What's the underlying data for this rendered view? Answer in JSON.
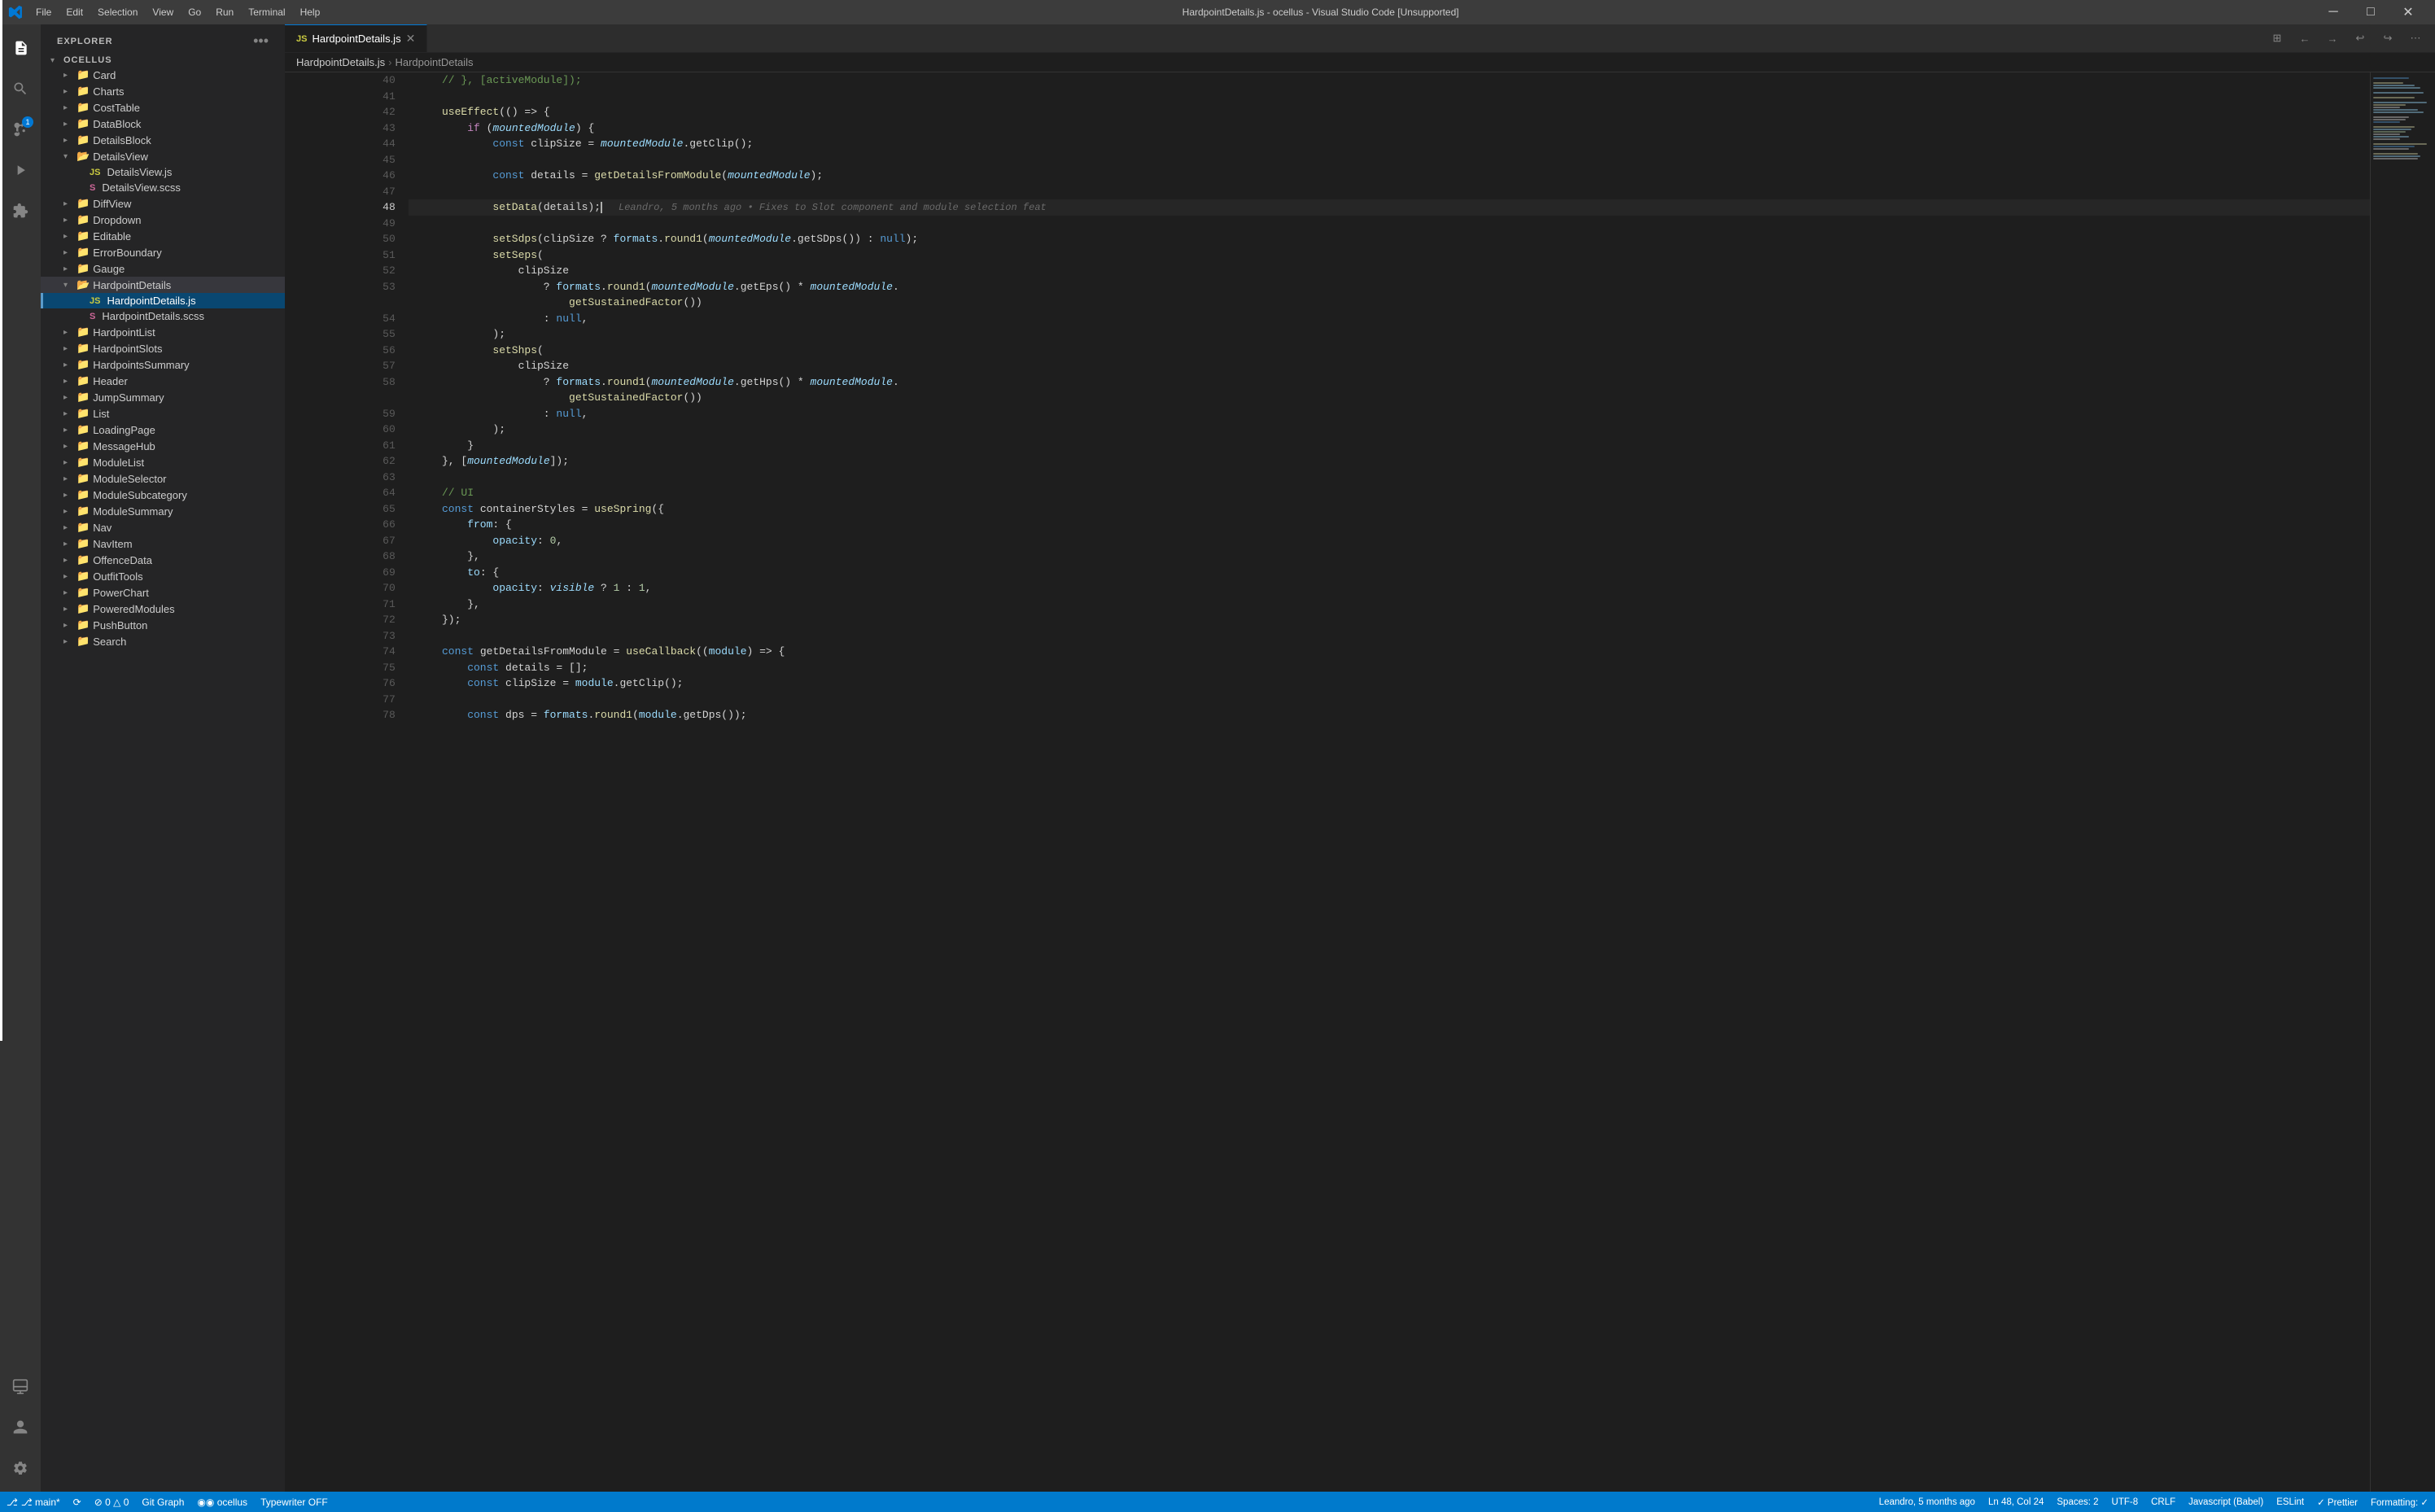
{
  "window": {
    "title": "HardpointDetails.js - ocellus - Visual Studio Code [Unsupported]",
    "menuItems": [
      "File",
      "Edit",
      "Selection",
      "View",
      "Go",
      "Run",
      "Terminal",
      "Help"
    ]
  },
  "activityBar": {
    "items": [
      {
        "name": "explorer",
        "icon": "📁",
        "active": true
      },
      {
        "name": "search",
        "icon": "🔍",
        "active": false
      },
      {
        "name": "source-control",
        "icon": "⑂",
        "active": false,
        "badge": "1"
      },
      {
        "name": "run-debug",
        "icon": "▷",
        "active": false
      },
      {
        "name": "extensions",
        "icon": "⊞",
        "active": false
      }
    ],
    "bottomItems": [
      {
        "name": "remote-explorer",
        "icon": "🖥"
      },
      {
        "name": "accounts",
        "icon": "👤"
      },
      {
        "name": "settings",
        "icon": "⚙"
      }
    ]
  },
  "sidebar": {
    "title": "Explorer",
    "moreIcon": "•••",
    "rootSection": "OCELLUS",
    "treeItems": [
      {
        "label": "Card",
        "type": "folder",
        "level": 2,
        "open": false
      },
      {
        "label": "Charts",
        "type": "folder",
        "level": 2,
        "open": false
      },
      {
        "label": "CostTable",
        "type": "folder",
        "level": 2,
        "open": false
      },
      {
        "label": "DataBlock",
        "type": "folder",
        "level": 2,
        "open": false
      },
      {
        "label": "DetailsBlock",
        "type": "folder",
        "level": 2,
        "open": false
      },
      {
        "label": "DetailsView",
        "type": "folder",
        "level": 2,
        "open": true
      },
      {
        "label": "DetailsView.js",
        "type": "file-js",
        "level": 3
      },
      {
        "label": "DetailsView.scss",
        "type": "file-scss",
        "level": 3
      },
      {
        "label": "DiffView",
        "type": "folder",
        "level": 2,
        "open": false
      },
      {
        "label": "Dropdown",
        "type": "folder",
        "level": 2,
        "open": false
      },
      {
        "label": "Editable",
        "type": "folder",
        "level": 2,
        "open": false
      },
      {
        "label": "ErrorBoundary",
        "type": "folder",
        "level": 2,
        "open": false
      },
      {
        "label": "Gauge",
        "type": "folder",
        "level": 2,
        "open": false
      },
      {
        "label": "HardpointDetails",
        "type": "folder",
        "level": 2,
        "open": true
      },
      {
        "label": "HardpointDetails.js",
        "type": "file-js",
        "level": 3,
        "active": true,
        "selected": true
      },
      {
        "label": "HardpointDetails.scss",
        "type": "file-scss",
        "level": 3
      },
      {
        "label": "HardpointList",
        "type": "folder",
        "level": 2,
        "open": false
      },
      {
        "label": "HardpointSlots",
        "type": "folder",
        "level": 2,
        "open": false
      },
      {
        "label": "HardpointsSummary",
        "type": "folder",
        "level": 2,
        "open": false
      },
      {
        "label": "Header",
        "type": "folder",
        "level": 2,
        "open": false
      },
      {
        "label": "JumpSummary",
        "type": "folder",
        "level": 2,
        "open": false
      },
      {
        "label": "List",
        "type": "folder",
        "level": 2,
        "open": false
      },
      {
        "label": "LoadingPage",
        "type": "folder",
        "level": 2,
        "open": false
      },
      {
        "label": "MessageHub",
        "type": "folder",
        "level": 2,
        "open": false
      },
      {
        "label": "ModuleList",
        "type": "folder",
        "level": 2,
        "open": false
      },
      {
        "label": "ModuleSelector",
        "type": "folder",
        "level": 2,
        "open": false
      },
      {
        "label": "ModuleSubcategory",
        "type": "folder",
        "level": 2,
        "open": false
      },
      {
        "label": "ModuleSummary",
        "type": "folder",
        "level": 2,
        "open": false
      },
      {
        "label": "Nav",
        "type": "folder",
        "level": 2,
        "open": false
      },
      {
        "label": "NavItem",
        "type": "folder",
        "level": 2,
        "open": false
      },
      {
        "label": "OffenceData",
        "type": "folder",
        "level": 2,
        "open": false
      },
      {
        "label": "OutfitTools",
        "type": "folder",
        "level": 2,
        "open": false
      },
      {
        "label": "PowerChart",
        "type": "folder",
        "level": 2,
        "open": false
      },
      {
        "label": "PoweredModules",
        "type": "folder",
        "level": 2,
        "open": false
      },
      {
        "label": "PushButton",
        "type": "folder",
        "level": 2,
        "open": false
      },
      {
        "label": "Search",
        "type": "folder",
        "level": 2,
        "open": false
      }
    ]
  },
  "editor": {
    "fileName": "HardpointDetails.js",
    "filePath": "HardpointDetails",
    "tabLabel": "HardpointDetails.js",
    "breadcrumb": [
      "HardpointDetails.js",
      "HardpointDetails"
    ],
    "lines": [
      {
        "num": 40,
        "content": "    // }, [activeModule]);",
        "tokens": [
          {
            "t": "cmt",
            "v": "// }, [activeModule]);"
          }
        ]
      },
      {
        "num": 41,
        "content": ""
      },
      {
        "num": 42,
        "content": "    useEffect(() => {",
        "tokens": [
          {
            "t": "fn",
            "v": "useEffect"
          },
          {
            "t": "punct",
            "v": "(() => {"
          }
        ]
      },
      {
        "num": 43,
        "content": "        if (mountedModule) {",
        "tokens": [
          {
            "t": "kw2",
            "v": "if"
          },
          {
            "t": "op",
            "v": " ("
          },
          {
            "t": "italic",
            "v": "mountedModule"
          },
          {
            "t": "op",
            "v": ") {"
          }
        ]
      },
      {
        "num": 44,
        "content": "            const clipSize = mountedModule.getClip();",
        "tokens": [
          {
            "t": "kw",
            "v": "const"
          },
          {
            "t": "op",
            "v": " clipSize = "
          },
          {
            "t": "italic",
            "v": "mountedModule"
          },
          {
            "t": "op",
            "v": ".getClip();"
          }
        ]
      },
      {
        "num": 45,
        "content": ""
      },
      {
        "num": 46,
        "content": "            const details = getDetailsFromModule(mountedModule);",
        "tokens": [
          {
            "t": "kw",
            "v": "const"
          },
          {
            "t": "op",
            "v": " details = "
          },
          {
            "t": "fn",
            "v": "getDetailsFromModule"
          },
          {
            "t": "op",
            "v": "("
          },
          {
            "t": "italic",
            "v": "mountedModule"
          },
          {
            "t": "op",
            "v": ");"
          }
        ]
      },
      {
        "num": 47,
        "content": ""
      },
      {
        "num": 48,
        "content": "            setData(details);",
        "blame": "Leandro, 5 months ago • Fixes to Slot component and module selection feat",
        "tokens": [
          {
            "t": "fn",
            "v": "setData"
          },
          {
            "t": "op",
            "v": "(details);"
          },
          {
            "t": "cursor",
            "v": ""
          }
        ],
        "active": true
      },
      {
        "num": 49,
        "content": ""
      },
      {
        "num": 50,
        "content": "            setSdps(clipSize ? formats.round1(mountedModule.getSDps()) : null);",
        "tokens": [
          {
            "t": "fn",
            "v": "setSdps"
          },
          {
            "t": "op",
            "v": "(clipSize ? "
          },
          {
            "t": "var",
            "v": "formats"
          },
          {
            "t": "op",
            "v": "."
          },
          {
            "t": "fn",
            "v": "round1"
          },
          {
            "t": "op",
            "v": "("
          },
          {
            "t": "italic",
            "v": "mountedModule"
          },
          {
            "t": "op",
            "v": ".getSDps()) : "
          },
          {
            "t": "kw",
            "v": "null"
          },
          {
            "t": "op",
            "v": ");"
          }
        ]
      },
      {
        "num": 51,
        "content": "            setSeps(",
        "tokens": [
          {
            "t": "fn",
            "v": "setSeps"
          },
          {
            "t": "op",
            "v": "("
          }
        ]
      },
      {
        "num": 52,
        "content": "                clipSize",
        "tokens": [
          {
            "t": "op",
            "v": "                clipSize"
          }
        ]
      },
      {
        "num": 53,
        "content": "                    ? formats.round1(mountedModule.getEps() * mountedModule.",
        "tokens": [
          {
            "t": "op",
            "v": "                    ? "
          },
          {
            "t": "var",
            "v": "formats"
          },
          {
            "t": "op",
            "v": "."
          },
          {
            "t": "fn",
            "v": "round1"
          },
          {
            "t": "op",
            "v": "("
          },
          {
            "t": "italic",
            "v": "mountedModule"
          },
          {
            "t": "op",
            "v": ".getEps() * "
          },
          {
            "t": "italic",
            "v": "mountedModule"
          },
          {
            "t": "op",
            "v": "."
          }
        ]
      },
      {
        "num": "",
        "content": "                        getSustainedFactor())",
        "tokens": [
          {
            "t": "fn",
            "v": "                        getSustainedFactor"
          },
          {
            "t": "op",
            "v": "())"
          }
        ]
      },
      {
        "num": 54,
        "content": "                    : null,",
        "tokens": [
          {
            "t": "op",
            "v": "                    : "
          },
          {
            "t": "kw",
            "v": "null"
          },
          {
            "t": "op",
            "v": ","
          }
        ]
      },
      {
        "num": 55,
        "content": "            );",
        "tokens": [
          {
            "t": "op",
            "v": "            );"
          }
        ]
      },
      {
        "num": 56,
        "content": "            setShps(",
        "tokens": [
          {
            "t": "fn",
            "v": "setShps"
          },
          {
            "t": "op",
            "v": "("
          }
        ]
      },
      {
        "num": 57,
        "content": "                clipSize",
        "tokens": [
          {
            "t": "op",
            "v": "                clipSize"
          }
        ]
      },
      {
        "num": 58,
        "content": "                    ? formats.round1(mountedModule.getHps() * mountedModule.",
        "tokens": [
          {
            "t": "op",
            "v": "                    ? "
          },
          {
            "t": "var",
            "v": "formats"
          },
          {
            "t": "op",
            "v": "."
          },
          {
            "t": "fn",
            "v": "round1"
          },
          {
            "t": "op",
            "v": "("
          },
          {
            "t": "italic",
            "v": "mountedModule"
          },
          {
            "t": "op",
            "v": ".getHps() * "
          },
          {
            "t": "italic",
            "v": "mountedModule"
          },
          {
            "t": "op",
            "v": "."
          }
        ]
      },
      {
        "num": "",
        "content": "                        getSustainedFactor())",
        "tokens": [
          {
            "t": "fn",
            "v": "                        getSustainedFactor"
          },
          {
            "t": "op",
            "v": "())"
          }
        ]
      },
      {
        "num": 59,
        "content": "                    : null,",
        "tokens": [
          {
            "t": "op",
            "v": "                    : "
          },
          {
            "t": "kw",
            "v": "null"
          },
          {
            "t": "op",
            "v": ","
          }
        ]
      },
      {
        "num": 60,
        "content": "            );",
        "tokens": [
          {
            "t": "op",
            "v": "            );"
          }
        ]
      },
      {
        "num": 61,
        "content": "        }",
        "tokens": [
          {
            "t": "op",
            "v": "        }"
          }
        ]
      },
      {
        "num": 62,
        "content": "    }, [mountedModule]);",
        "tokens": [
          {
            "t": "op",
            "v": "    }, ["
          },
          {
            "t": "italic",
            "v": "mountedModule"
          },
          {
            "t": "op",
            "v": "]);"
          }
        ]
      },
      {
        "num": 63,
        "content": ""
      },
      {
        "num": 64,
        "content": "    // UI",
        "tokens": [
          {
            "t": "cmt",
            "v": "    // UI"
          }
        ]
      },
      {
        "num": 65,
        "content": "    const containerStyles = useSpring({",
        "tokens": [
          {
            "t": "kw",
            "v": "    const"
          },
          {
            "t": "op",
            "v": " containerStyles = "
          },
          {
            "t": "fn",
            "v": "useSpring"
          },
          {
            "t": "op",
            "v": "({"
          }
        ]
      },
      {
        "num": 66,
        "content": "        from: {",
        "tokens": [
          {
            "t": "prop",
            "v": "        from"
          },
          {
            "t": "op",
            "v": ": {"
          }
        ]
      },
      {
        "num": 67,
        "content": "            opacity: 0,",
        "tokens": [
          {
            "t": "prop",
            "v": "            opacity"
          },
          {
            "t": "op",
            "v": ": "
          },
          {
            "t": "num",
            "v": "0"
          },
          {
            "t": "op",
            "v": ","
          }
        ]
      },
      {
        "num": 68,
        "content": "        },",
        "tokens": [
          {
            "t": "op",
            "v": "        },"
          }
        ]
      },
      {
        "num": 69,
        "content": "        to: {",
        "tokens": [
          {
            "t": "prop",
            "v": "        to"
          },
          {
            "t": "op",
            "v": ": {"
          }
        ]
      },
      {
        "num": 70,
        "content": "            opacity: visible ? 1 : 1,",
        "tokens": [
          {
            "t": "prop",
            "v": "            opacity"
          },
          {
            "t": "op",
            "v": ": "
          },
          {
            "t": "italic",
            "v": "visible"
          },
          {
            "t": "op",
            "v": " ? "
          },
          {
            "t": "num",
            "v": "1"
          },
          {
            "t": "op",
            "v": " : "
          },
          {
            "t": "num",
            "v": "1"
          },
          {
            "t": "op",
            "v": ","
          }
        ]
      },
      {
        "num": 71,
        "content": "        },",
        "tokens": [
          {
            "t": "op",
            "v": "        },"
          }
        ]
      },
      {
        "num": 72,
        "content": "    });",
        "tokens": [
          {
            "t": "op",
            "v": "    });"
          }
        ]
      },
      {
        "num": 73,
        "content": ""
      },
      {
        "num": 74,
        "content": "    const getDetailsFromModule = useCallback((module) => {",
        "tokens": [
          {
            "t": "kw",
            "v": "    const"
          },
          {
            "t": "op",
            "v": " getDetailsFromModule = "
          },
          {
            "t": "fn",
            "v": "useCallback"
          },
          {
            "t": "op",
            "v": "(("
          },
          {
            "t": "var",
            "v": "module"
          },
          {
            "t": "op",
            "v": ") => {"
          }
        ]
      },
      {
        "num": 75,
        "content": "        const details = [];",
        "tokens": [
          {
            "t": "kw",
            "v": "        const"
          },
          {
            "t": "op",
            "v": " details = [];"
          }
        ]
      },
      {
        "num": 76,
        "content": "        const clipSize = module.getClip();",
        "tokens": [
          {
            "t": "kw",
            "v": "        const"
          },
          {
            "t": "op",
            "v": " clipSize = "
          },
          {
            "t": "var",
            "v": "module"
          },
          {
            "t": "op",
            "v": ".getClip();"
          }
        ]
      },
      {
        "num": 77,
        "content": ""
      },
      {
        "num": 78,
        "content": "        const dps = formats.round1(module.getDps());",
        "tokens": [
          {
            "t": "kw",
            "v": "        const"
          },
          {
            "t": "op",
            "v": " dps = "
          },
          {
            "t": "var",
            "v": "formats"
          },
          {
            "t": "op",
            "v": "."
          },
          {
            "t": "fn",
            "v": "round1"
          },
          {
            "t": "op",
            "v": "("
          },
          {
            "t": "var",
            "v": "module"
          },
          {
            "t": "op",
            "v": ".getDps());"
          }
        ]
      }
    ]
  },
  "statusBar": {
    "leftItems": [
      {
        "label": "⎇ main*",
        "icon": "branch"
      },
      {
        "label": "⟳",
        "icon": "sync"
      },
      {
        "label": "⊘ 0 △ 0",
        "icon": "errors"
      },
      {
        "label": "Git Graph"
      },
      {
        "label": "◉ ocellus"
      },
      {
        "label": "Typewriter OFF"
      }
    ],
    "rightItems": [
      {
        "label": "Leandro, 5 months ago"
      },
      {
        "label": "Ln 48, Col 24"
      },
      {
        "label": "Spaces: 2"
      },
      {
        "label": "UTF-8"
      },
      {
        "label": "CRLF"
      },
      {
        "label": "Javascript (Babel)"
      },
      {
        "label": "ESLint"
      },
      {
        "label": "✓ Prettier"
      },
      {
        "label": "Formatting: ✓"
      }
    ]
  }
}
